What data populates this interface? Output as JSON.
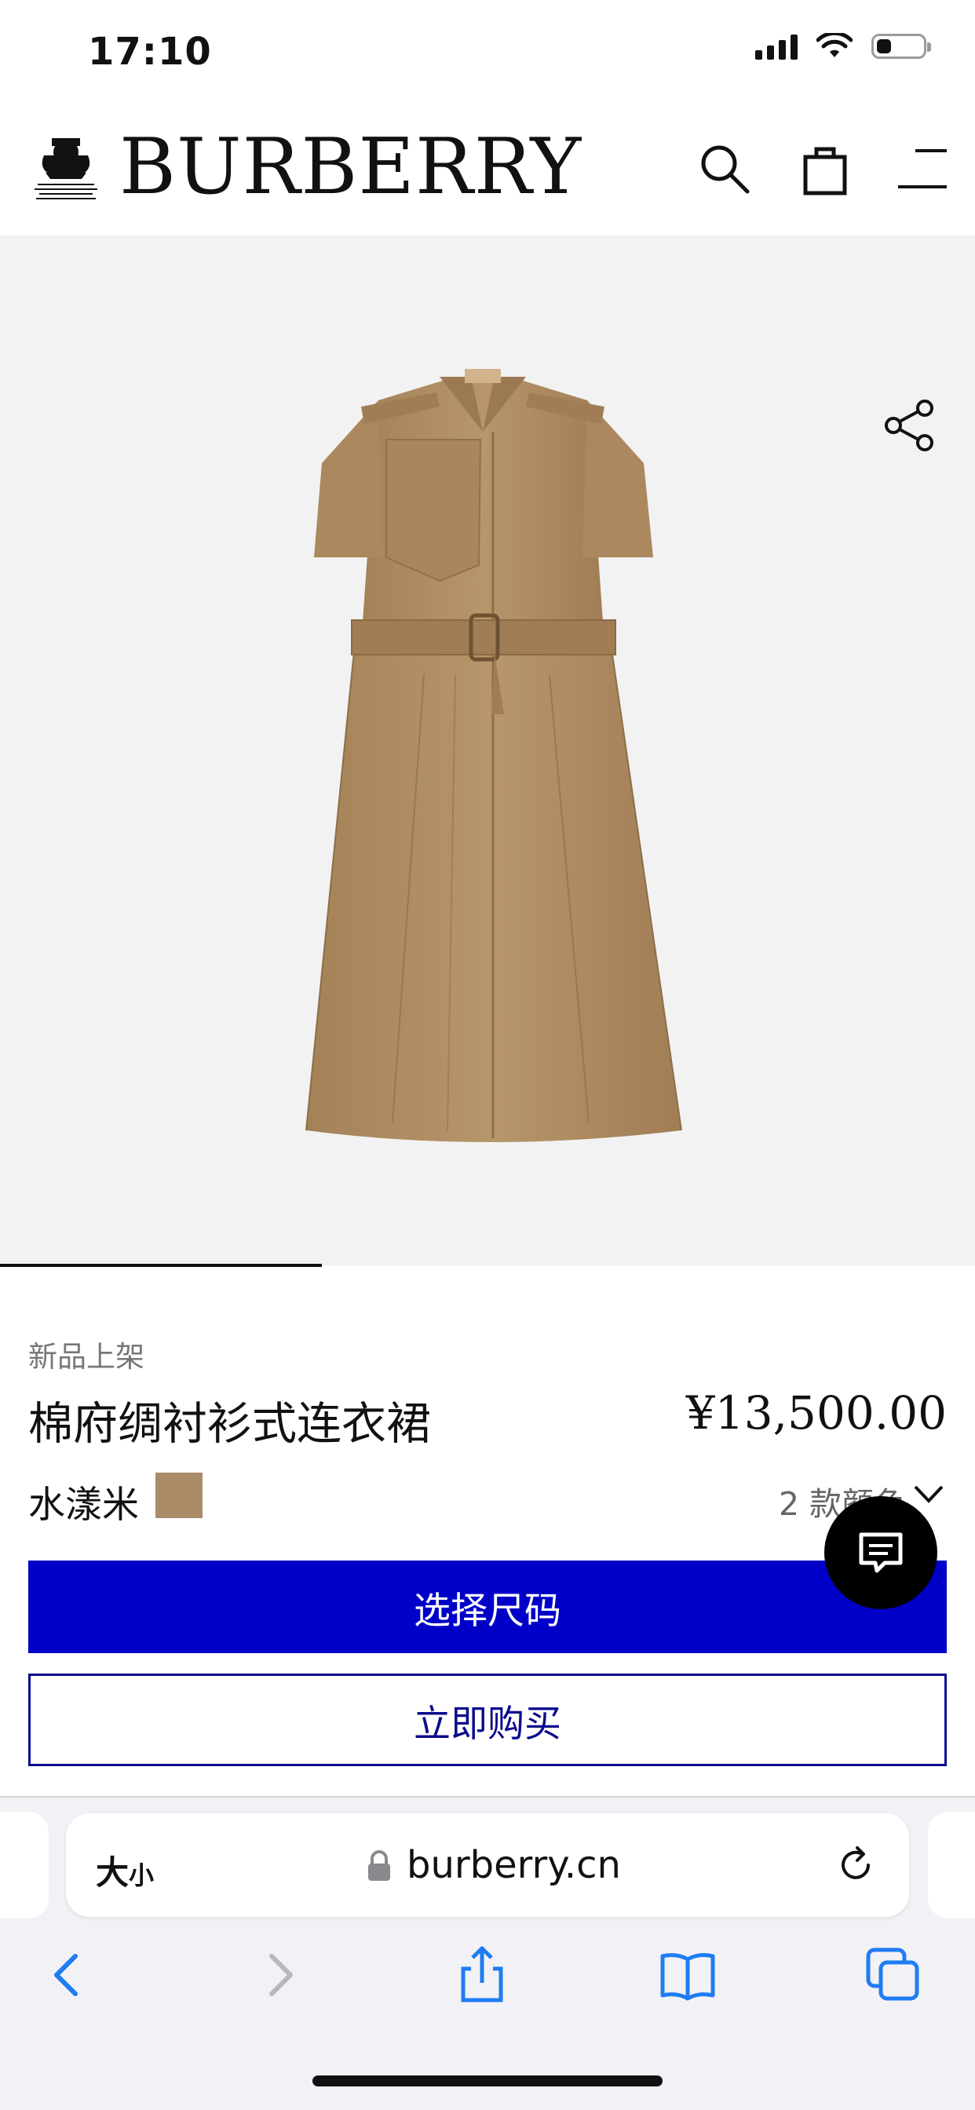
{
  "status_bar": {
    "time": "17:10"
  },
  "header": {
    "brand": "BURBERRY",
    "crest_text": "BY APPOINTMENT TO HER MAJESTY THE QUEEN OUTFITTERS BURBERRY LIMITED LONDON",
    "icons": [
      "search-icon",
      "shopping-bag-icon",
      "menu-icon"
    ]
  },
  "product": {
    "badge": "新品上架",
    "title": "棉府绸衬衫式连衣裙",
    "price": "¥13,500.00",
    "color_name": "水漾米",
    "swatch_color": "#a98b68",
    "color_count": "2 款颜色",
    "select_size_label": "选择尺码",
    "buy_now_label": "立即购买",
    "image_progress": 0.33,
    "dress_color": "#b08c63"
  },
  "browser": {
    "text_size_label": "大",
    "text_size_small": "小",
    "url": "burberry.cn",
    "accent_color": "#1f7cf3",
    "primary_button_color": "#0000c8"
  }
}
